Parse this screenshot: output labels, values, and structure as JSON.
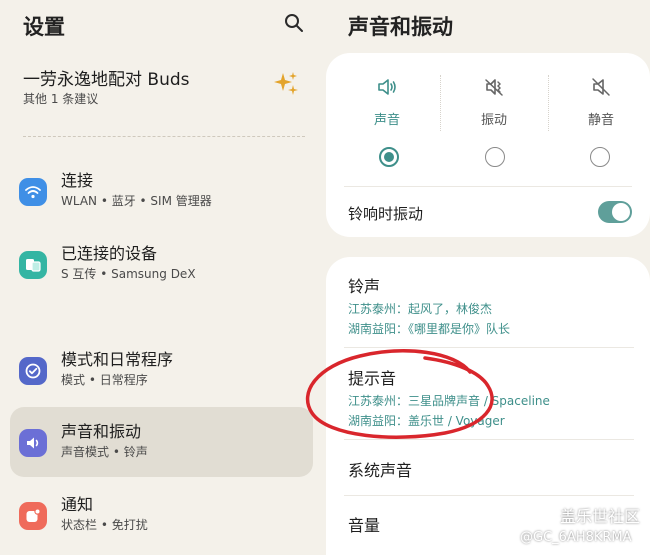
{
  "settings": {
    "title": "设置",
    "buds_suggestion": {
      "title": "一劳永逸地配对 Buds",
      "subtitle": "其他 1 条建议"
    },
    "items": [
      {
        "label": "连接",
        "subtitle": "WLAN • 蓝牙 • SIM 管理器",
        "icon": "wifi-icon",
        "color": "#3f8fe6",
        "selected": false
      },
      {
        "label": "已连接的设备",
        "subtitle": "S 互传 • Samsung DeX",
        "icon": "devices-icon",
        "color": "#34b5a3",
        "selected": false
      },
      {
        "label": "模式和日常程序",
        "subtitle": "模式 • 日常程序",
        "icon": "check-circle-icon",
        "color": "#5468c9",
        "selected": false
      },
      {
        "label": "声音和振动",
        "subtitle": "声音模式 • 铃声",
        "icon": "volume-icon",
        "color": "#6b6fd6",
        "selected": true
      },
      {
        "label": "通知",
        "subtitle": "状态栏 • 免打扰",
        "icon": "notification-icon",
        "color": "#ef6b5b",
        "selected": false
      }
    ]
  },
  "sound": {
    "title": "声音和振动",
    "modes": [
      {
        "label": "声音",
        "icon": "sound-icon",
        "checked": true
      },
      {
        "label": "振动",
        "icon": "vibrate-icon",
        "checked": false
      },
      {
        "label": "静音",
        "icon": "mute-icon",
        "checked": false
      }
    ],
    "vibrate_while_ringing": {
      "label": "铃响时振动",
      "on": true
    },
    "ringtone": {
      "title": "铃声",
      "lines": [
        "江苏泰州：起风了，林俊杰",
        "湖南益阳：《哪里都是你》队长"
      ]
    },
    "notification_sound": {
      "title": "提示音",
      "lines": [
        "江苏泰州：三星品牌声音 / Spaceline",
        "湖南益阳：盖乐世 / Voyager"
      ]
    },
    "system_sound": {
      "title": "系统声音"
    },
    "volume": {
      "title": "音量"
    }
  },
  "watermark": {
    "line1": "盖乐世社区",
    "line2": "@GC_6AH8KRMA"
  },
  "colors": {
    "accent": "#3e8f8a",
    "background": "#f4f1ea",
    "annotation": "#d9262c"
  }
}
